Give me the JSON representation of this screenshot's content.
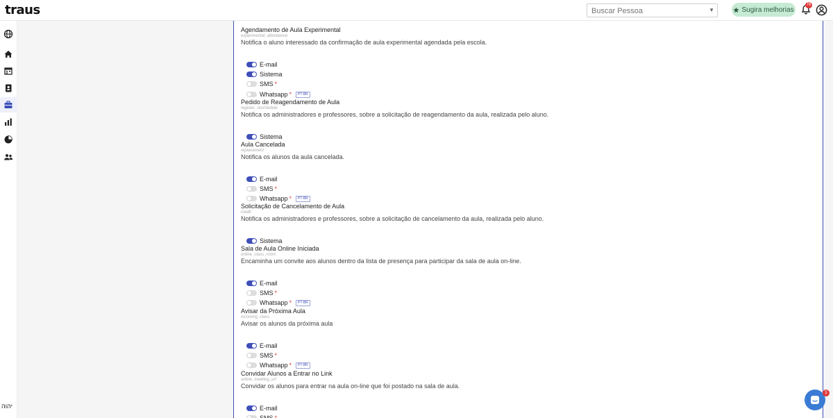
{
  "header": {
    "logo": "traus",
    "search_placeholder": "Buscar Pessoa",
    "suggest_label": "Sugira melhorias",
    "bell_count": "78",
    "icons": [
      "bell-icon",
      "user-circle-icon",
      "star-icon"
    ]
  },
  "sidebar": {
    "icons": [
      "globe-icon",
      "home-icon",
      "calendar-icon",
      "contacts-icon",
      "briefcase-icon",
      "bar-chart-icon",
      "pie-chart-icon",
      "users-icon"
    ],
    "active": "briefcase-icon",
    "user_label": "יהוה"
  },
  "channel_labels": {
    "email": "E-mail",
    "system": "Sistema",
    "sms": "SMS",
    "whatsapp": "Whatsapp",
    "required_mark": "*",
    "lang_tag": "PT-BR"
  },
  "notifications": [
    {
      "title": "Agendamento de Aula Experimental",
      "key": "experimental_attendance",
      "desc": "Notifica o aluno interessado da confirmação de aula experimental agendada pela escola.",
      "channels": [
        {
          "type": "email",
          "on": true
        },
        {
          "type": "system",
          "on": true
        },
        {
          "type": "sms",
          "on": false
        },
        {
          "type": "whatsapp",
          "on": false
        }
      ]
    },
    {
      "title": "Pedido de Reagendamento de Aula",
      "key": "register_reschedule",
      "desc": "Notifica os administradores e professores, sobre a solicitação de reagendamento da aula, realizada pelo aluno.",
      "channels": [
        {
          "type": "system",
          "on": true
        }
      ]
    },
    {
      "title": "Aula Cancelada",
      "key": "replacement",
      "desc": "Notifica os alunos da aula cancelada.",
      "channels": [
        {
          "type": "email",
          "on": true
        },
        {
          "type": "sms",
          "on": false
        },
        {
          "type": "whatsapp",
          "on": false
        }
      ]
    },
    {
      "title": "Solicitação de Cancelamento de Aula",
      "key": "credit",
      "desc": "Notifica os administradores e professores, sobre a solicitação de cancelamento da aula, realizada pelo aluno.",
      "channels": [
        {
          "type": "system",
          "on": true
        }
      ]
    },
    {
      "title": "Sala de Aula Online Iniciada",
      "key": "online_class_room",
      "desc": "Encaminha um convite aos alunos dentro da lista de presença para participar da sala de aula on-line.",
      "channels": [
        {
          "type": "email",
          "on": true
        },
        {
          "type": "sms",
          "on": false
        },
        {
          "type": "whatsapp",
          "on": false
        }
      ]
    },
    {
      "title": "Avisar da Próxima Aula",
      "key": "incoming_class",
      "desc": "Avisar os alunos da próxima aula",
      "channels": [
        {
          "type": "email",
          "on": true
        },
        {
          "type": "sms",
          "on": false
        },
        {
          "type": "whatsapp",
          "on": false
        }
      ]
    },
    {
      "title": "Convidar Alunos a Entrar no Link",
      "key": "online_meeting_url",
      "desc": "Convidar os alunos para entrar na aula on-line que foi postado na sala de aula.",
      "channels": [
        {
          "type": "email",
          "on": true
        },
        {
          "type": "sms",
          "on": false
        }
      ]
    }
  ],
  "chat": {
    "badge": "1",
    "icon": "chat-icon"
  },
  "colors": {
    "accent": "#3e4fb8",
    "suggest_bg": "#c6ead4",
    "badge": "#e03a3a",
    "chat": "#3a7bd5"
  }
}
